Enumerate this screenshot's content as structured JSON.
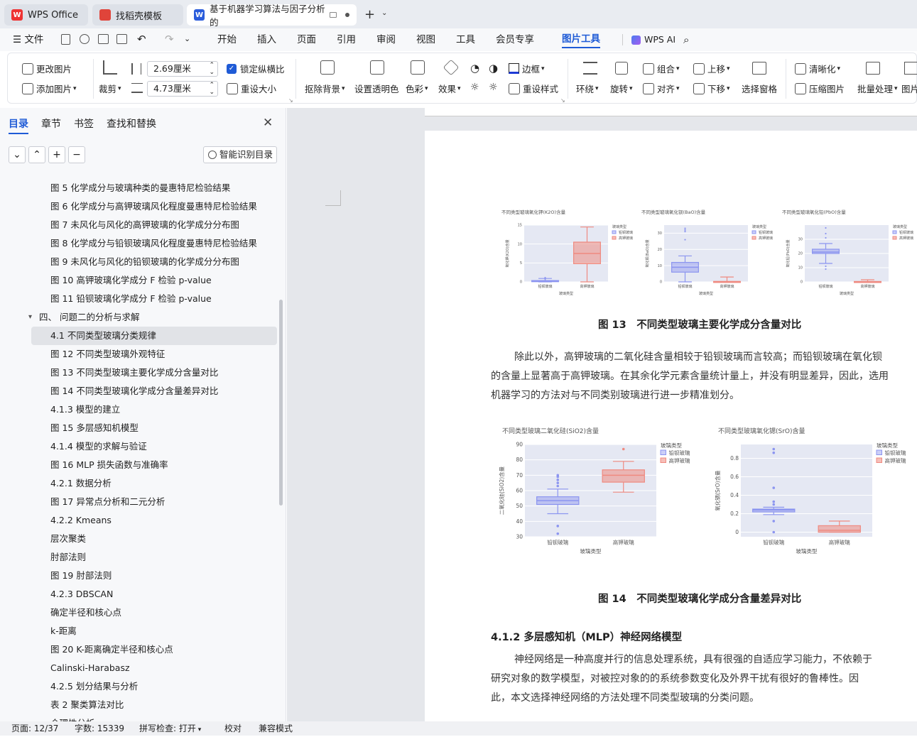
{
  "tabs": {
    "t1": "WPS Office",
    "t2": "找稻壳模板",
    "t3": "基于机器学习算法与因子分析的",
    "t1_logo": "W",
    "t3_logo": "W"
  },
  "menu": {
    "file": "文件",
    "items": [
      "开始",
      "插入",
      "页面",
      "引用",
      "审阅",
      "视图",
      "工具",
      "会员专享",
      "图片工具"
    ],
    "wps_ai": "WPS AI"
  },
  "ribbon": {
    "change_image": "更改图片",
    "add_image": "添加图片",
    "crop": "裁剪",
    "height_value": "2.69厘米",
    "width_value": "4.73厘米",
    "lock_ratio": "锁定纵横比",
    "reset_size": "重设大小",
    "remove_bg": "抠除背景",
    "set_transparent": "设置透明色",
    "color": "色彩",
    "effect": "效果",
    "border": "边框",
    "reset_style": "重设样式",
    "wrap": "环绕",
    "rotate": "旋转",
    "group": "组合",
    "align": "对齐",
    "bring_forward": "上移",
    "send_backward": "下移",
    "select_pane": "选择窗格",
    "sharpen": "清晰化",
    "compress": "压缩图片",
    "batch": "批量处理",
    "image_more": "图片"
  },
  "sidebar": {
    "tabs": [
      "目录",
      "章节",
      "书签",
      "查找和替换"
    ],
    "smart_toc": "智能识别目录",
    "items": [
      "图 5 化学成分与玻璃种类的曼惠特尼检验结果",
      "图 6 化学成分与高钾玻璃风化程度曼惠特尼检验结果",
      "图 7 未风化与风化的高钾玻璃的化学成分分布图",
      "图 8 化学成分与铅钡玻璃风化程度曼惠特尼检验结果",
      "图 9 未风化与风化的铅钡玻璃的化学成分分布图",
      "图 10 高钾玻璃化学成分 F 检验 p-value",
      "图 11 铅钡玻璃化学成分 F 检验 p-value",
      "四、 问题二的分析与求解",
      "4.1 不同类型玻璃分类规律",
      "图 12 不同类型玻璃外观特征",
      "图 13 不同类型玻璃主要化学成分含量对比",
      "图 14 不同类型玻璃化学成分含量差异对比",
      "4.1.3 模型的建立",
      "图 15 多层感知机模型",
      "4.1.4 模型的求解与验证",
      "图 16 MLP 损失函数与准确率",
      "4.2.1 数据分析",
      "图 17 异常点分析和二元分析",
      "4.2.2 Kmeans",
      "层次聚类",
      "肘部法则",
      "图 19 肘部法则",
      "4.2.3 DBSCAN",
      "确定半径和核心点",
      "k-距离",
      "图 20 K-距离确定半径和核心点",
      "Calinski-Harabasz",
      "4.2.5 划分结果与分析",
      "表 2 聚类算法对比",
      "合理性分析"
    ]
  },
  "doc": {
    "fig13_caption": "图 13　不同类型玻璃主要化学成分含量对比",
    "para1_l1": "除此以外，高钾玻璃的二氧化硅含量相较于铅钡玻璃而言较高；而铅钡玻璃在氧化钡",
    "para1_l2": "的含量上显著高于高钾玻璃。在其余化学元素含量统计量上，并没有明显差异，因此，选用",
    "para1_l3": "机器学习的方法对与不同类别玻璃进行进一步精准划分。",
    "fig14_caption": "图 14　不同类型玻璃化学成分含量差异对比",
    "heading": "4.1.2 多层感知机（MLP）神经网络模型",
    "para2_l1": "神经网络是一种高度并行的信息处理系统，具有很强的自适应学习能力，不依赖于",
    "para2_l2": "研究对象的数学模型，对被控对象的的系统参数变化及外界干扰有很好的鲁棒性。因",
    "para2_l3": "此，本文选择神经网络的方法处理不同类型玻璃的分类问题。"
  },
  "status": {
    "page": "页面: 12/37",
    "words": "字数: 15339",
    "spell": "拼写检查: 打开",
    "proof": "校对",
    "compat": "兼容模式"
  },
  "colors": {
    "lead_barium": "#8c95f0",
    "high_potassium": "#ef8a80",
    "plot_bg": "#e5e8f3",
    "accent": "#1f5bd6"
  },
  "chart_data": [
    {
      "type": "box",
      "title": "不同类型玻璃氧化钾(K2O)含量",
      "xlabel": "玻璃类型",
      "ylabel": "氧化钾(K2O)含量",
      "categories": [
        "铅钡玻璃",
        "高钾玻璃"
      ],
      "ylim": [
        0,
        15
      ],
      "yticks": [
        0,
        5,
        10,
        15
      ],
      "legend_title": "玻璃类型",
      "boxes": [
        {
          "name": "铅钡玻璃",
          "min": 0,
          "q1": 0.05,
          "median": 0.2,
          "q3": 0.35,
          "max": 0.9,
          "outliers": [
            1.1,
            0.8
          ]
        },
        {
          "name": "高钾玻璃",
          "min": 0,
          "q1": 4.8,
          "median": 7.5,
          "q3": 10.5,
          "max": 14.5,
          "outliers": []
        }
      ]
    },
    {
      "type": "box",
      "title": "不同类型玻璃氧化钡(BaO)含量",
      "xlabel": "玻璃类型",
      "ylabel": "氧化钡(BaO)含量",
      "categories": [
        "铅钡玻璃",
        "高钾玻璃"
      ],
      "ylim": [
        0,
        35
      ],
      "yticks": [
        0,
        10,
        20,
        30
      ],
      "legend_title": "玻璃类型",
      "boxes": [
        {
          "name": "铅钡玻璃",
          "min": 0,
          "q1": 6,
          "median": 9,
          "q3": 12,
          "max": 16,
          "outliers": [
            26,
            31,
            32,
            33
          ]
        },
        {
          "name": "高钾玻璃",
          "min": 0,
          "q1": 0,
          "median": 0,
          "q3": 0.3,
          "max": 3,
          "outliers": []
        }
      ]
    },
    {
      "type": "box",
      "title": "不同类型玻璃氧化铅(PbO)含量",
      "xlabel": "玻璃类型",
      "ylabel": "氧化铅(PbO)含量",
      "categories": [
        "铅钡玻璃",
        "高钾玻璃"
      ],
      "ylim": [
        0,
        40
      ],
      "yticks": [
        0,
        10,
        20,
        30
      ],
      "legend_title": "玻璃类型",
      "boxes": [
        {
          "name": "铅钡玻璃",
          "min": 13,
          "q1": 20,
          "median": 21,
          "q3": 23,
          "max": 27,
          "outliers": [
            9,
            11,
            31,
            34,
            38
          ]
        },
        {
          "name": "高钾玻璃",
          "min": 0,
          "q1": 0,
          "median": 0,
          "q3": 0.3,
          "max": 1.5,
          "outliers": []
        }
      ]
    },
    {
      "type": "box",
      "title": "不同类型玻璃二氧化硅(SiO2)含量",
      "xlabel": "玻璃类型",
      "ylabel": "二氧化硅(SiO2)含量",
      "categories": [
        "铅钡玻璃",
        "高钾玻璃"
      ],
      "ylim": [
        30,
        90
      ],
      "yticks": [
        30,
        40,
        50,
        60,
        70,
        80,
        90
      ],
      "legend_title": "玻璃类型",
      "boxes": [
        {
          "name": "铅钡玻璃",
          "min": 45,
          "q1": 51,
          "median": 53.5,
          "q3": 56,
          "max": 61,
          "outliers": [
            32,
            37,
            63,
            65,
            67,
            69,
            70
          ]
        },
        {
          "name": "高钾玻璃",
          "min": 59,
          "q1": 65.5,
          "median": 70,
          "q3": 73.5,
          "max": 79,
          "outliers": [
            87
          ]
        }
      ]
    },
    {
      "type": "box",
      "title": "不同类型玻璃氧化锶(SrO)含量",
      "xlabel": "玻璃类型",
      "ylabel": "氧化锶(SrO)含量",
      "categories": [
        "铅钡玻璃",
        "高钾玻璃"
      ],
      "ylim": [
        -0.05,
        0.95
      ],
      "yticks": [
        0,
        0.2,
        0.4,
        0.6,
        0.8
      ],
      "legend_title": "玻璃类型",
      "boxes": [
        {
          "name": "铅钡玻璃",
          "min": 0.19,
          "q1": 0.22,
          "median": 0.24,
          "q3": 0.25,
          "max": 0.27,
          "outliers": [
            0,
            0.12,
            0.3,
            0.33,
            0.48,
            0.86,
            0.9
          ]
        },
        {
          "name": "高钾玻璃",
          "min": 0,
          "q1": 0,
          "median": 0.02,
          "q3": 0.07,
          "max": 0.12,
          "outliers": []
        }
      ]
    }
  ]
}
